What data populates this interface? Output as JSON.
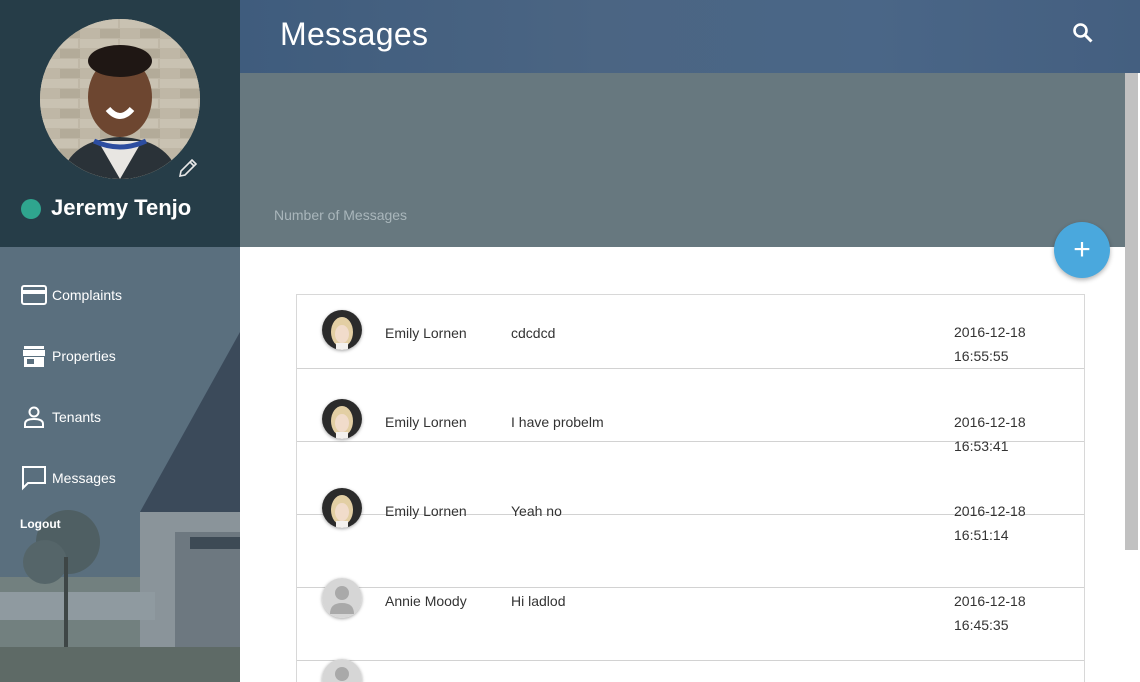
{
  "user": {
    "name": "Jeremy Tenjo",
    "status_color": "#2fa58e"
  },
  "nav": {
    "items": [
      {
        "label": "Complaints",
        "icon": "credit-card-icon"
      },
      {
        "label": "Properties",
        "icon": "store-icon"
      },
      {
        "label": "Tenants",
        "icon": "person-icon"
      },
      {
        "label": "Messages",
        "icon": "chat-bubble-icon"
      }
    ],
    "logout": "Logout"
  },
  "header": {
    "title": "Messages",
    "search_icon": "search-icon"
  },
  "banner": {
    "label": "Number of Messages"
  },
  "fab": {
    "label": "+",
    "icon": "add-icon",
    "color": "#4aa8dd"
  },
  "messages": [
    {
      "sender": "Emily Lornen",
      "text": "cdcdcd",
      "date": "2016-12-18",
      "time": "16:55:55",
      "avatar": "photo"
    },
    {
      "sender": "Emily Lornen",
      "text": "I have probelm",
      "date": "2016-12-18",
      "time": "16:53:41",
      "avatar": "photo"
    },
    {
      "sender": "Emily Lornen",
      "text": "Yeah no",
      "date": "2016-12-18",
      "time": "16:51:14",
      "avatar": "photo"
    },
    {
      "sender": "Annie Moody",
      "text": "Hi ladlod",
      "date": "2016-12-18",
      "time": "16:45:35",
      "avatar": "placeholder"
    },
    {
      "sender": "",
      "text": "",
      "date": "",
      "time": "",
      "avatar": "placeholder"
    }
  ]
}
